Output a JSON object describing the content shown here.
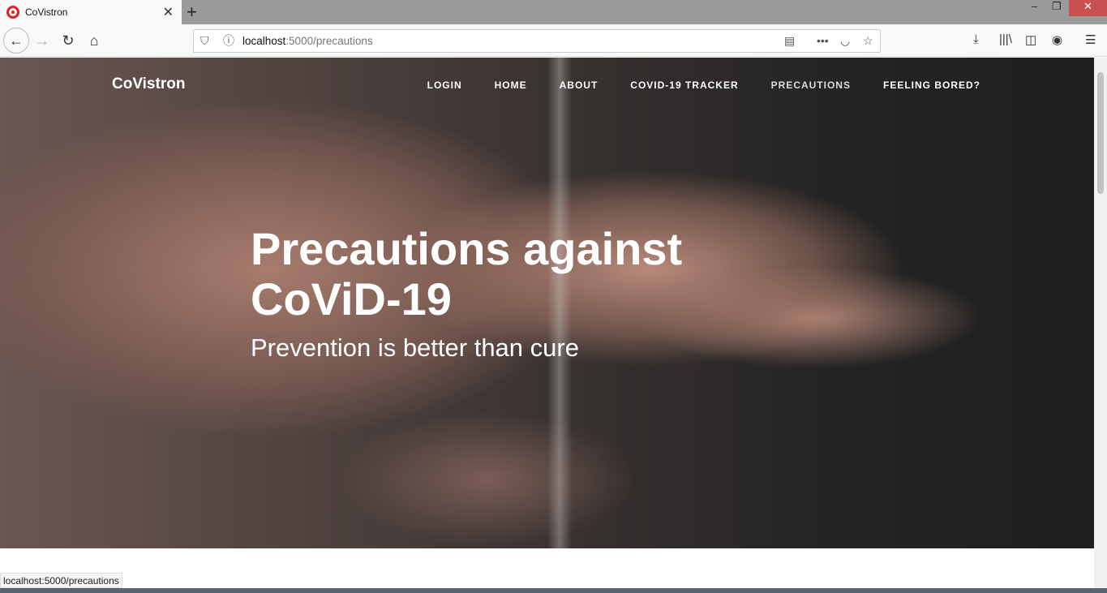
{
  "browser": {
    "tab_title": "CoVistron",
    "url_host": "localhost",
    "url_rest": ":5000/precautions",
    "status_text": "localhost:5000/precautions"
  },
  "site": {
    "brand": "CoVistron",
    "nav": [
      {
        "label": "LOGIN"
      },
      {
        "label": "HOME"
      },
      {
        "label": "ABOUT"
      },
      {
        "label": "COVID-19 TRACKER"
      },
      {
        "label": "PRECAUTIONS"
      },
      {
        "label": "FEELING BORED?"
      }
    ],
    "hero_title": "Precautions against CoViD-19",
    "hero_subtitle": "Prevention is better than cure"
  }
}
